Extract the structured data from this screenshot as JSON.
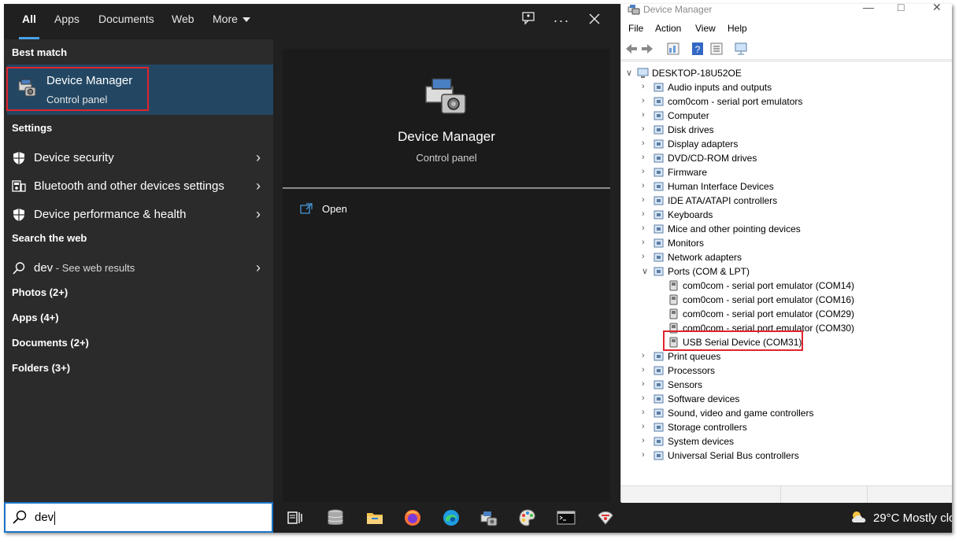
{
  "search": {
    "tabs": [
      "All",
      "Apps",
      "Documents",
      "Web",
      "More"
    ],
    "query": "dev",
    "best_match_heading": "Best match",
    "best_match": {
      "title": "Device Manager",
      "subtitle": "Control panel"
    },
    "settings_heading": "Settings",
    "settings_items": [
      "Device security",
      "Bluetooth and other devices settings",
      "Device performance & health"
    ],
    "web_heading": "Search the web",
    "web_item": {
      "query": "dev",
      "suffix": " - See web results"
    },
    "categories": [
      "Photos (2+)",
      "Apps (4+)",
      "Documents (2+)",
      "Folders (3+)"
    ],
    "preview": {
      "title": "Device Manager",
      "subtitle": "Control panel",
      "open_label": "Open"
    }
  },
  "taskbar": {
    "icons": [
      "task-view-icon",
      "database-icon",
      "file-explorer-icon",
      "firefox-icon",
      "edge-icon",
      "device-manager-icon",
      "paint-icon",
      "terminal-icon",
      "network-tool-icon"
    ],
    "weather": "29°C  Mostly clo"
  },
  "device_manager": {
    "title": "Device Manager",
    "menu": [
      "File",
      "Action",
      "View",
      "Help"
    ],
    "root": "DESKTOP-18U52OE",
    "categories": [
      "Audio inputs and outputs",
      "com0com - serial port emulators",
      "Computer",
      "Disk drives",
      "Display adapters",
      "DVD/CD-ROM drives",
      "Firmware",
      "Human Interface Devices",
      "IDE ATA/ATAPI controllers",
      "Keyboards",
      "Mice and other pointing devices",
      "Monitors",
      "Network adapters",
      "Ports (COM & LPT)",
      "Print queues",
      "Processors",
      "Sensors",
      "Software devices",
      "Sound, video and game controllers",
      "Storage controllers",
      "System devices",
      "Universal Serial Bus controllers"
    ],
    "ports_children": [
      "com0com - serial port emulator (COM14)",
      "com0com - serial port emulator (COM16)",
      "com0com - serial port emulator (COM29)",
      "com0com - serial port emulator (COM30)",
      "USB Serial Device (COM31)"
    ]
  },
  "colors": {
    "accent": "#4aa0e6",
    "highlight_box": "#e0242d",
    "selection": "#234763"
  }
}
